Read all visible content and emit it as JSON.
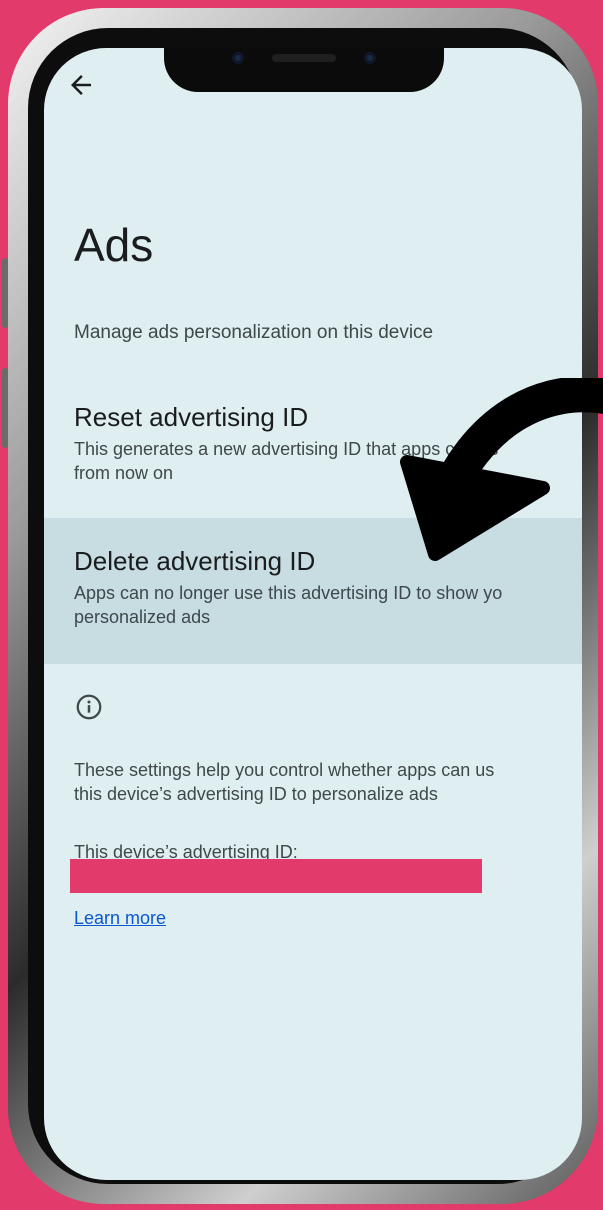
{
  "colors": {
    "background": "#e23a6a",
    "screen": "#dfeef1",
    "highlight": "#c7dde2",
    "link": "#0b57d0",
    "arrow": "#000000"
  },
  "header": {
    "back_icon": "arrow-left-icon",
    "title": "Ads",
    "subtitle": "Manage ads personalization on this device"
  },
  "settings": {
    "reset": {
      "title": "Reset advertising ID",
      "description_line1": "This generates a new advertising ID that apps can us",
      "description_line2": "from now on"
    },
    "delete": {
      "title": "Delete advertising ID",
      "description_line1": "Apps can no longer use this advertising ID to show yo",
      "description_line2": "personalized ads"
    }
  },
  "info": {
    "icon": "info-icon",
    "text_line1": "These settings help you control whether apps can us",
    "text_line2": "this device’s advertising ID to personalize ads",
    "id_label": "This device’s advertising ID:",
    "learn_more": "Learn more"
  }
}
